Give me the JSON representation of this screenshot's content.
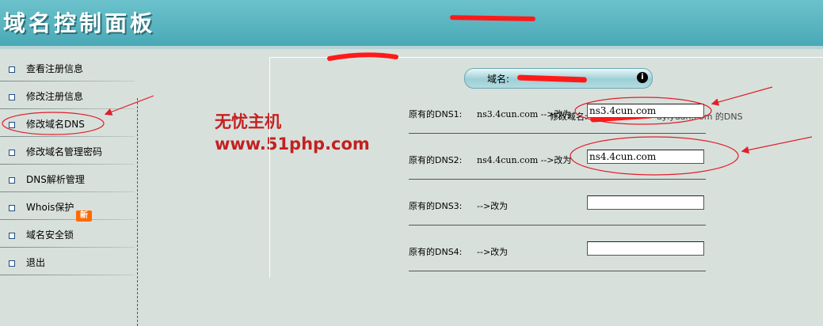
{
  "header": {
    "title": "域名控制面板"
  },
  "sidebar": {
    "items": [
      {
        "label": "查看注册信息"
      },
      {
        "label": "修改注册信息"
      },
      {
        "label": "修改域名DNS"
      },
      {
        "label": "修改域名管理密码"
      },
      {
        "label": "DNS解析管理"
      },
      {
        "label": "Whois保护"
      },
      {
        "label": "域名安全锁"
      },
      {
        "label": "退出"
      }
    ],
    "new_badge": "新"
  },
  "watermark": {
    "line1": "无忧主机",
    "line2": "www.51php.com"
  },
  "panel": {
    "legend_prefix": "修改域名:",
    "legend_suffix": "uyiyuan.com 的DNS",
    "pill_label": "域名:",
    "info_icon": "i"
  },
  "dns": [
    {
      "label": "原有的DNS1:",
      "old_text": "ns3.4cun.com -->改为",
      "new_value": "ns3.4cun.com"
    },
    {
      "label": "原有的DNS2:",
      "old_text": "ns4.4cun.com -->改为",
      "new_value": "ns4.4cun.com"
    },
    {
      "label": "原有的DNS3:",
      "old_text": "-->改为",
      "new_value": ""
    },
    {
      "label": "原有的DNS4:",
      "old_text": "-->改为",
      "new_value": ""
    }
  ],
  "colors": {
    "header": "#49a9b6",
    "background": "#d8e0dc",
    "annotation_red": "#e0202a",
    "watermark": "#c32121"
  }
}
